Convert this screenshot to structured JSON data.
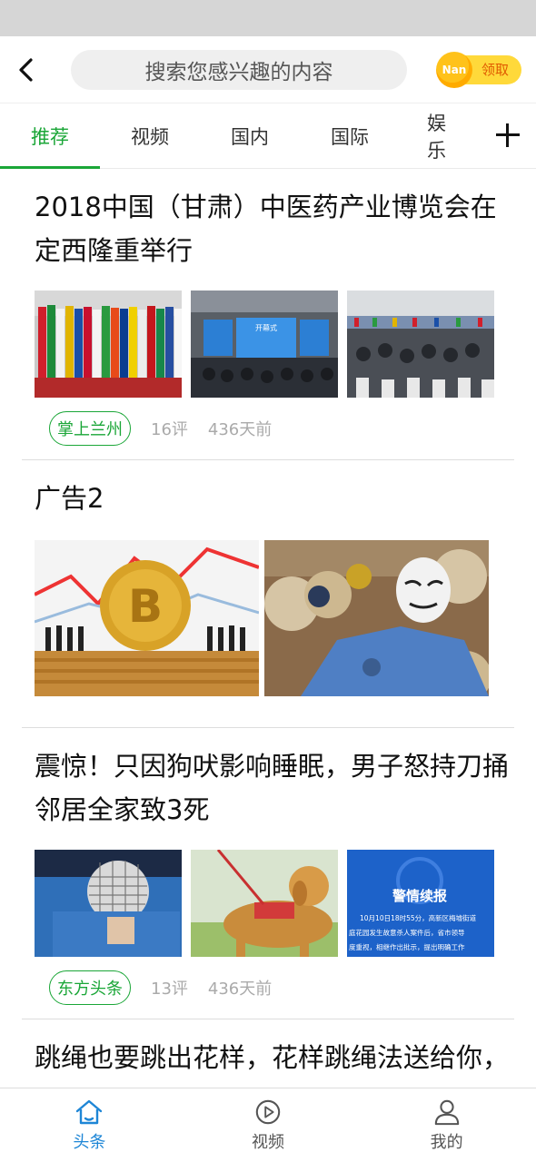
{
  "header": {
    "search_placeholder": "搜索您感兴趣的内容",
    "reward_coin": "Nan",
    "reward_label": "领取"
  },
  "tabs": [
    {
      "label": "推荐",
      "active": true
    },
    {
      "label": "视频"
    },
    {
      "label": "国内"
    },
    {
      "label": "国际"
    },
    {
      "label": "娱乐"
    }
  ],
  "articles": [
    {
      "title": "2018中国（甘肃）中医药产业博览会在定西隆重举行",
      "source": "掌上兰州",
      "comments": "16评",
      "time": "436天前"
    },
    {
      "title": "广告2"
    },
    {
      "title": "震惊！只因狗吠影响睡眠，男子怒持刀捅邻居全家致3死",
      "source": "东方头条",
      "comments": "13评",
      "time": "436天前",
      "image_caption": "警情续报",
      "image_text_1": "10月10日18时55分，高新区梅墟街道",
      "image_text_2": "庭花园发生故意杀人案件后，省市领导",
      "image_text_3": "度重视，相继作出批示，提出明确工作"
    },
    {
      "title": "跳绳也要跳出花样，花样跳绳法送给你，助你轻松燃脂"
    }
  ],
  "banner_texts": {
    "screen_left": "开幕式"
  },
  "bottom_nav": [
    {
      "label": "头条",
      "icon": "home-icon",
      "active": true
    },
    {
      "label": "视频",
      "icon": "play-icon"
    },
    {
      "label": "我的",
      "icon": "user-icon"
    }
  ],
  "colors": {
    "accent_green": "#1aa637",
    "active_blue": "#1e86d6",
    "reward_yellow": "#ffd93a"
  }
}
